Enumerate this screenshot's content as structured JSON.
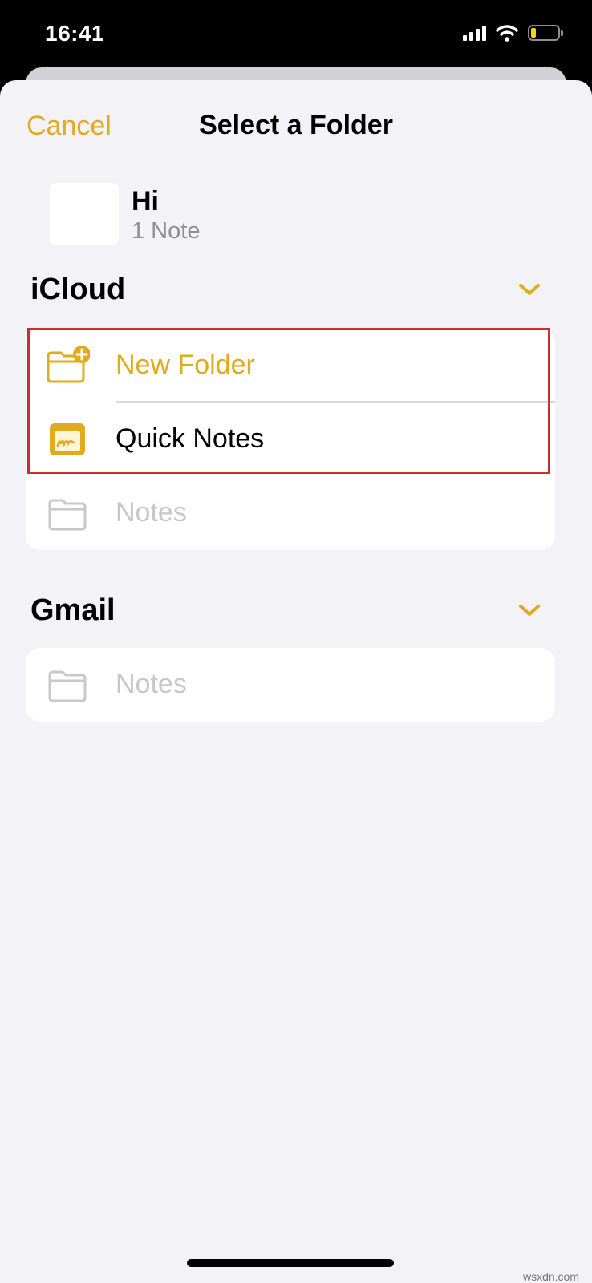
{
  "status_bar": {
    "time": "16:41"
  },
  "nav": {
    "cancel_label": "Cancel",
    "title": "Select a Folder"
  },
  "note": {
    "title": "Hi",
    "count": "1 Note"
  },
  "sections": {
    "icloud": {
      "title": "iCloud",
      "items": [
        {
          "label": "New Folder",
          "icon": "folder-plus-icon",
          "state": "action"
        },
        {
          "label": "Quick Notes",
          "icon": "quick-notes-icon",
          "state": "enabled"
        },
        {
          "label": "Notes",
          "icon": "folder-icon",
          "state": "disabled"
        }
      ]
    },
    "gmail": {
      "title": "Gmail",
      "items": [
        {
          "label": "Notes",
          "icon": "folder-icon",
          "state": "disabled"
        }
      ]
    }
  },
  "watermark": "wsxdn.com",
  "colors": {
    "accent": "#e0ab1c",
    "highlight": "#d02a33",
    "disabled": "#c7c7cc",
    "background": "#f2f2f7"
  }
}
